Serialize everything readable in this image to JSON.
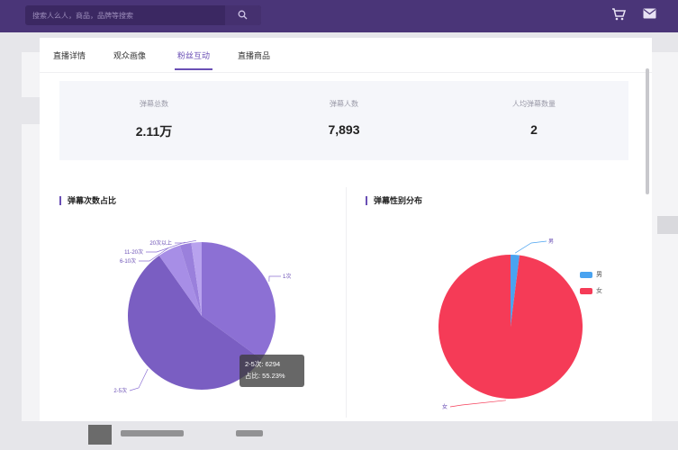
{
  "header": {
    "search_placeholder": "搜索人么人，商品，品牌等搜索",
    "icons": [
      "search-icon",
      "cart-icon",
      "mail-icon"
    ]
  },
  "modal": {
    "tabs": [
      {
        "label": "直播详情"
      },
      {
        "label": "观众画像"
      },
      {
        "label": "粉丝互动"
      },
      {
        "label": "直播商品"
      }
    ],
    "active_tab": 2,
    "stats": [
      {
        "label": "弹幕总数",
        "value": "2.11万"
      },
      {
        "label": "弹幕人数",
        "value": "7,893"
      },
      {
        "label": "人均弹幕数量",
        "value": "2"
      }
    ],
    "left_chart_title": "弹幕次数占比",
    "right_chart_title": "弹幕性别分布",
    "tooltip": {
      "line1": "2-5次: 6294",
      "line2": "占比: 55.23%"
    }
  },
  "colors": {
    "header_bg": "#4a3578",
    "accent": "#6a4fb5",
    "purple_dark": "#7a5ec2",
    "purple_mid": "#8c70d4",
    "purple_light": "#a78ee6",
    "male": "#4aa3f0",
    "female": "#f53b57"
  },
  "chart_data": [
    {
      "type": "pie",
      "title": "弹幕次数占比",
      "slices": [
        {
          "label": "1次",
          "value": 35
        },
        {
          "label": "2-5次",
          "value": 55.23
        },
        {
          "label": "6-10次",
          "value": 5
        },
        {
          "label": "11-20次",
          "value": 2.5
        },
        {
          "label": "20次以上",
          "value": 2.27
        }
      ]
    },
    {
      "type": "pie",
      "title": "弹幕性别分布",
      "slices": [
        {
          "label": "男",
          "value": 2
        },
        {
          "label": "女",
          "value": 98
        }
      ],
      "legend": [
        "男",
        "女"
      ],
      "legend_position": "right"
    }
  ]
}
